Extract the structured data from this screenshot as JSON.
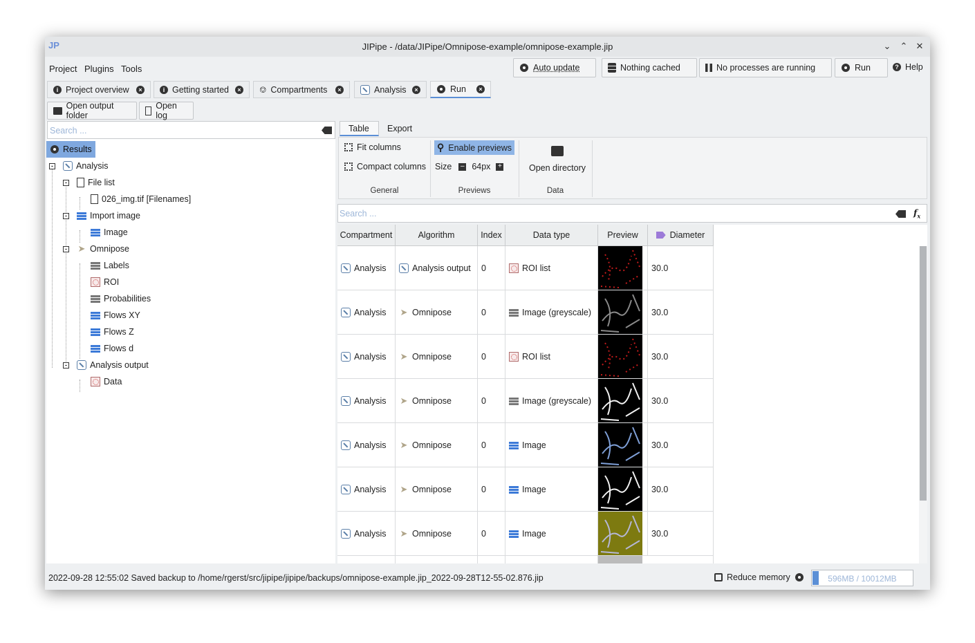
{
  "window": {
    "title": "JIPipe - /data/JIPipe/Omnipose-example/omnipose-example.jip"
  },
  "menu": [
    "Project",
    "Plugins",
    "Tools"
  ],
  "toolbar": {
    "auto_update": "Auto update",
    "cache": "Nothing cached",
    "processes": "No processes are running",
    "run": "Run",
    "help": "Help"
  },
  "tabs": [
    "Project overview",
    "Getting started",
    "Compartments",
    "Analysis",
    "Run"
  ],
  "actions": {
    "open_output_folder": "Open output folder",
    "open_log": "Open log"
  },
  "left": {
    "search_placeholder": "Search ...",
    "tree": {
      "root": "Results",
      "analysis": "Analysis",
      "file_list": "File list",
      "file_item": "026_img.tif [Filenames]",
      "import_image": "Import image",
      "image": "Image",
      "omnipose": "Omnipose",
      "omnipose_children": [
        "Labels",
        "ROI",
        "Probabilities",
        "Flows XY",
        "Flows Z",
        "Flows d"
      ],
      "analysis_output": "Analysis output",
      "data": "Data"
    }
  },
  "right": {
    "subtabs": [
      "Table",
      "Export"
    ],
    "ribbon": {
      "fit_columns": "Fit columns",
      "compact_columns": "Compact columns",
      "general": "General",
      "enable_previews": "Enable previews",
      "size_label": "Size",
      "size_value": "64px",
      "previews": "Previews",
      "open_directory": "Open directory",
      "data": "Data"
    },
    "search_placeholder": "Search ...",
    "columns": [
      "Compartment",
      "Algorithm",
      "Index",
      "Data type",
      "Preview",
      "Diameter"
    ],
    "rows": [
      {
        "compartment": "Analysis",
        "algorithm": "Analysis output",
        "index": "0",
        "data_type": "ROI list",
        "preview": "roi",
        "diameter": "30.0"
      },
      {
        "compartment": "Analysis",
        "algorithm": "Omnipose",
        "index": "0",
        "data_type": "Image (greyscale)",
        "preview": "grey-dim",
        "diameter": "30.0"
      },
      {
        "compartment": "Analysis",
        "algorithm": "Omnipose",
        "index": "0",
        "data_type": "ROI list",
        "preview": "roi",
        "diameter": "30.0"
      },
      {
        "compartment": "Analysis",
        "algorithm": "Omnipose",
        "index": "0",
        "data_type": "Image (greyscale)",
        "preview": "grey",
        "diameter": "30.0"
      },
      {
        "compartment": "Analysis",
        "algorithm": "Omnipose",
        "index": "0",
        "data_type": "Image",
        "preview": "color",
        "diameter": "30.0"
      },
      {
        "compartment": "Analysis",
        "algorithm": "Omnipose",
        "index": "0",
        "data_type": "Image",
        "preview": "grey",
        "diameter": "30.0"
      },
      {
        "compartment": "Analysis",
        "algorithm": "Omnipose",
        "index": "0",
        "data_type": "Image",
        "preview": "olive",
        "diameter": "30.0"
      }
    ]
  },
  "status": {
    "message": "2022-09-28 12:55:02 Saved backup to /home/rgerst/src/jipipe/jipipe/backups/omnipose-example.jip_2022-09-28T12-55-02.876.jip",
    "reduce_memory": "Reduce memory",
    "memory": "596MB / 10012MB",
    "memory_fraction": 0.06
  },
  "colors": {
    "accent": "#5b8fd6",
    "selection": "#7fa8df"
  }
}
